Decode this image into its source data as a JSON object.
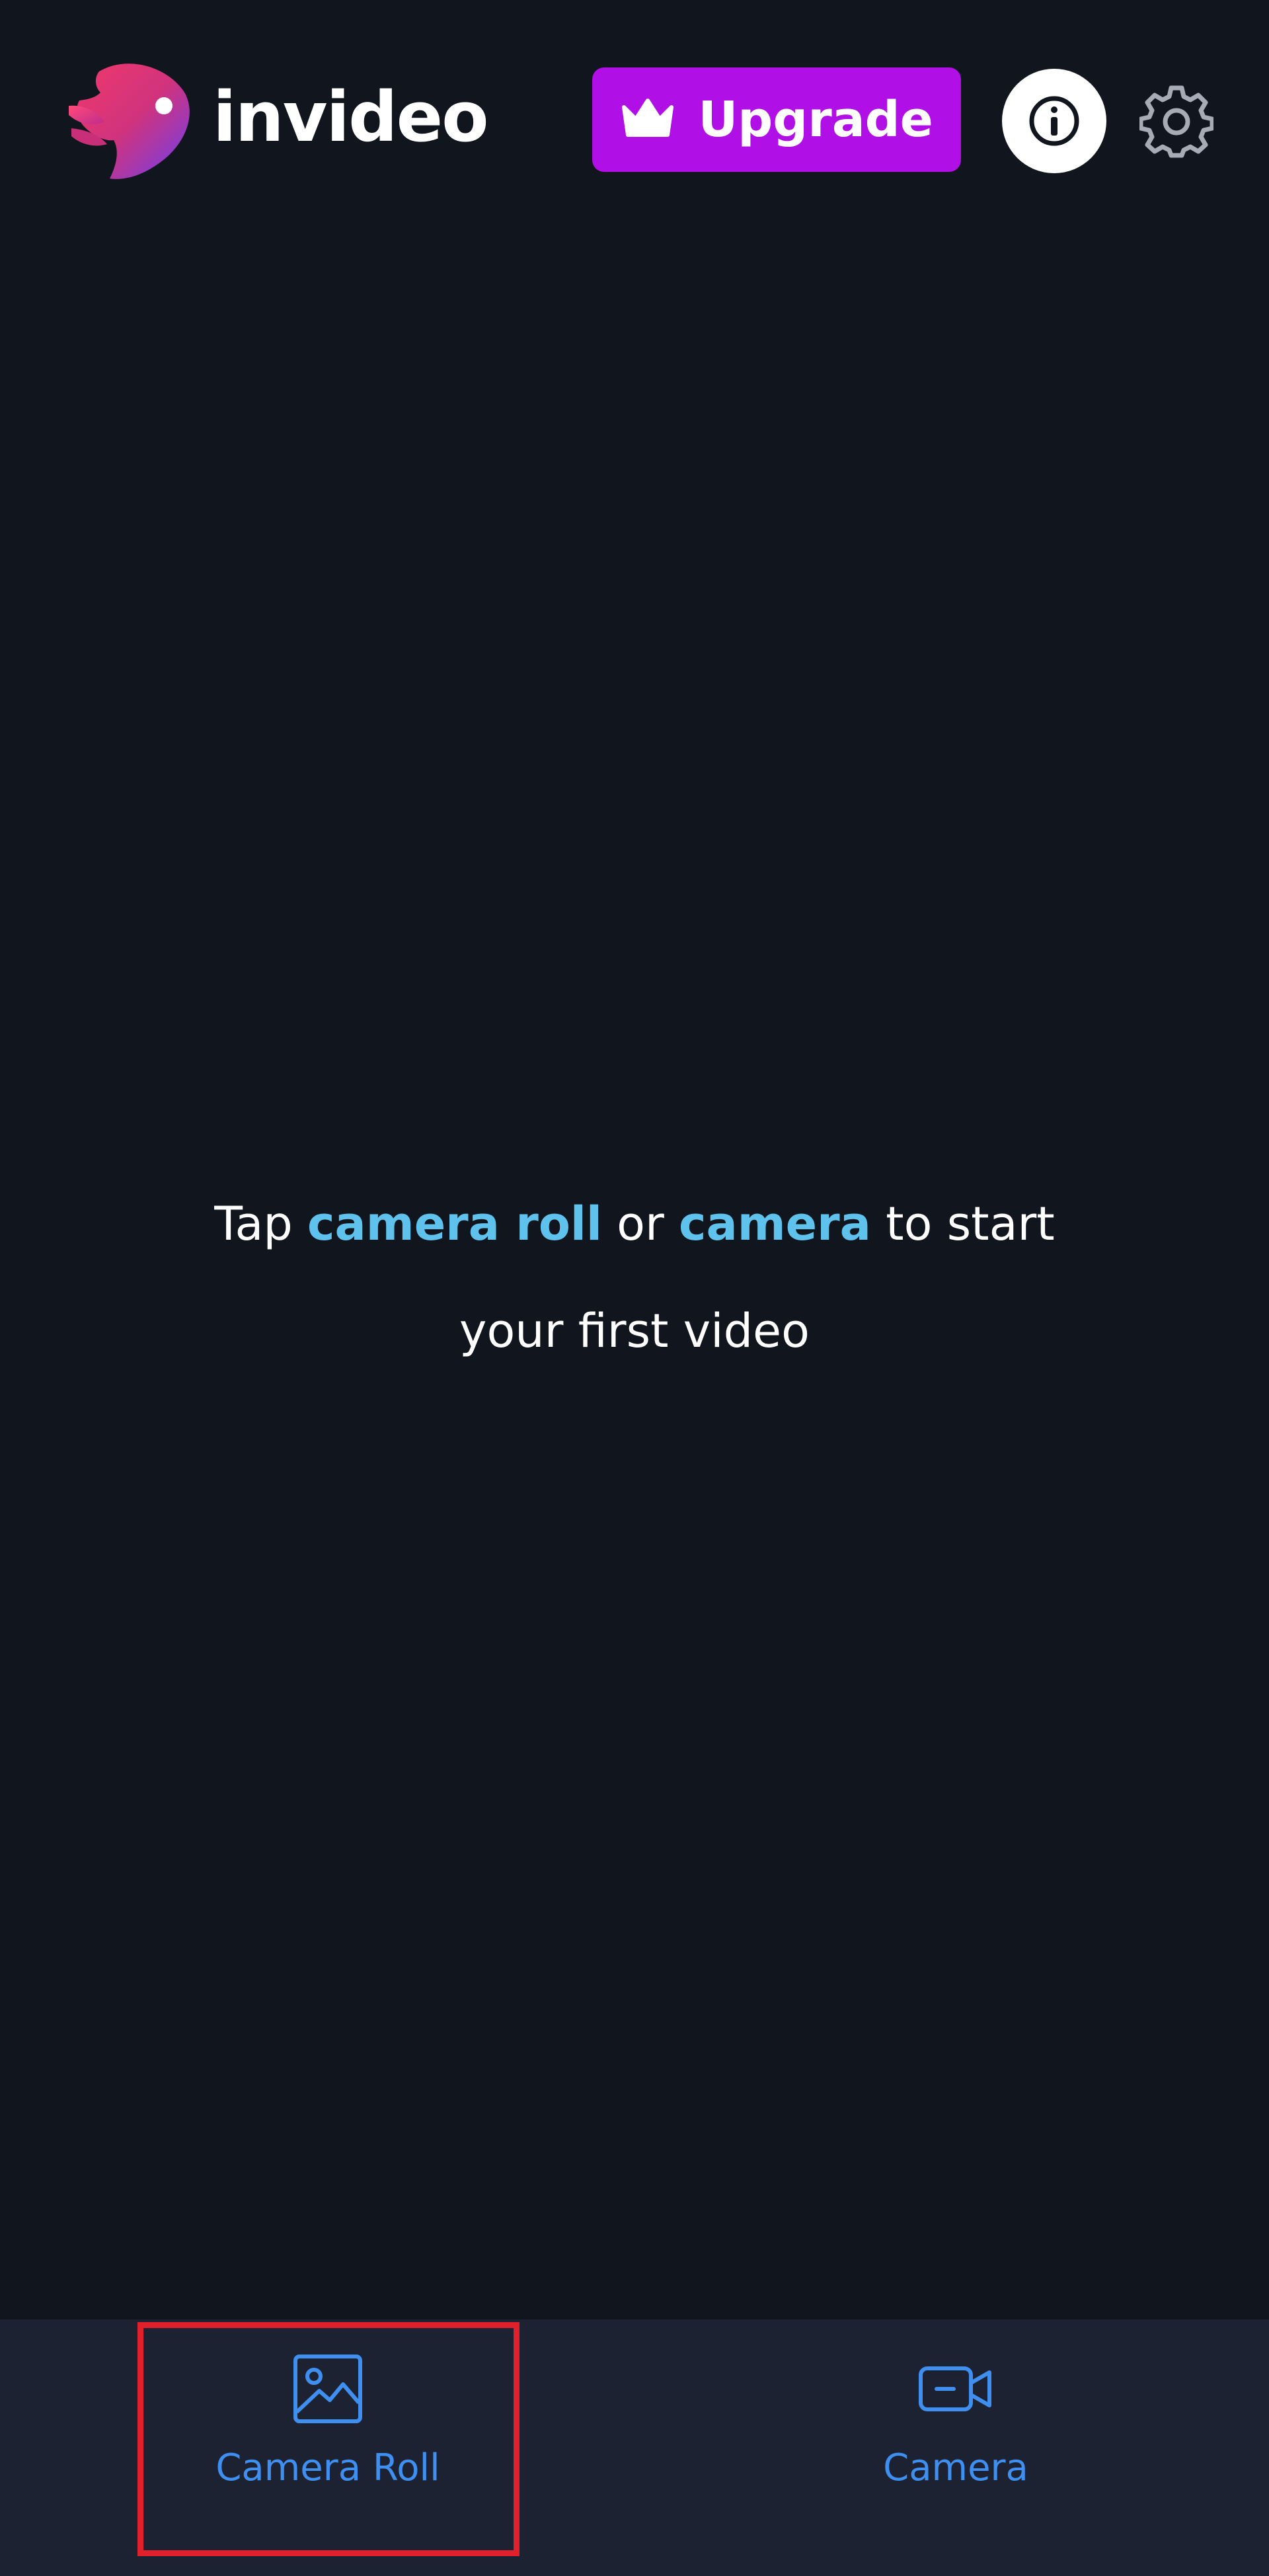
{
  "header": {
    "app_name": "invideo",
    "upgrade_label": "Upgrade",
    "info_icon": "info-icon",
    "settings_icon": "gear-icon",
    "upgrade_icon": "crown-icon"
  },
  "empty_state": {
    "prefix": "Tap ",
    "camera_roll_link": "camera roll",
    "connector": " or ",
    "camera_link": "camera",
    "suffix_line1": " to start",
    "line2": "your first video"
  },
  "tabbar": {
    "camera_roll_label": "Camera Roll",
    "camera_label": "Camera",
    "camera_roll_icon": "image-icon",
    "camera_icon": "video-camera-icon"
  },
  "colors": {
    "background": "#11151e",
    "tabbar_background": "#1d2232",
    "upgrade_purple": "#b010e6",
    "link_blue": "#5ec2ec",
    "tab_blue": "#3f8ff0",
    "highlight_red": "#e0212b"
  }
}
